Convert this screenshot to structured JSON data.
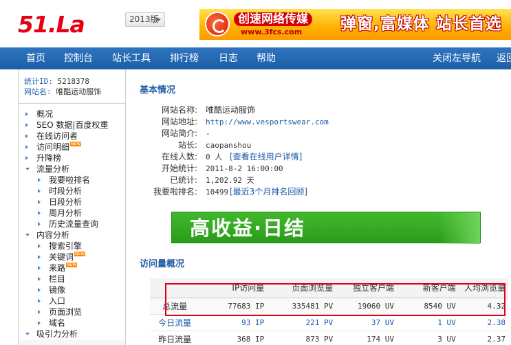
{
  "header": {
    "logo": "51.La",
    "version_label": "2013版",
    "banner": {
      "left_text": "创速网络传媒",
      "url_text": "www.3fcs.com",
      "right_text": "弹窗,富媒体 站长首选"
    }
  },
  "nav": {
    "items": [
      "首页",
      "控制台",
      "站长工具",
      "排行榜",
      "日志",
      "帮助"
    ],
    "right_items": [
      "关闭左导航",
      "返回"
    ]
  },
  "sidebar": {
    "site_id_label": "统计ID:",
    "site_id": "5218378",
    "site_name_label": "网站名:",
    "site_name": "唯酷运动服饰",
    "new_badge": "NEW",
    "menu": [
      {
        "label": "概况",
        "level": 1,
        "open": false,
        "new": false
      },
      {
        "label": "SEO 数据|百度权重",
        "level": 1,
        "open": false,
        "new": false
      },
      {
        "label": "在线访问者",
        "level": 1,
        "open": false,
        "new": false
      },
      {
        "label": "访问明细",
        "level": 1,
        "open": false,
        "new": true
      },
      {
        "label": "升降榜",
        "level": 1,
        "open": false,
        "new": false
      },
      {
        "label": "流量分析",
        "level": 1,
        "open": true,
        "new": false
      },
      {
        "label": "我要啦排名",
        "level": 2,
        "open": false,
        "new": false
      },
      {
        "label": "时段分析",
        "level": 2,
        "open": false,
        "new": false
      },
      {
        "label": "日段分析",
        "level": 2,
        "open": false,
        "new": false
      },
      {
        "label": "周月分析",
        "level": 2,
        "open": false,
        "new": false
      },
      {
        "label": "历史流量查询",
        "level": 2,
        "open": false,
        "new": false
      },
      {
        "label": "内容分析",
        "level": 1,
        "open": true,
        "new": false
      },
      {
        "label": "搜索引擎",
        "level": 2,
        "open": false,
        "new": false
      },
      {
        "label": "关键词",
        "level": 2,
        "open": false,
        "new": true
      },
      {
        "label": "来路",
        "level": 2,
        "open": false,
        "new": true
      },
      {
        "label": "栏目",
        "level": 2,
        "open": false,
        "new": false
      },
      {
        "label": "镜像",
        "level": 2,
        "open": false,
        "new": false
      },
      {
        "label": "入口",
        "level": 2,
        "open": false,
        "new": false
      },
      {
        "label": "页面浏览",
        "level": 2,
        "open": false,
        "new": false
      },
      {
        "label": "域名",
        "level": 2,
        "open": false,
        "new": false
      },
      {
        "label": "吸引力分析",
        "level": 1,
        "open": true,
        "new": false
      }
    ]
  },
  "main": {
    "basic_title": "基本情况",
    "basic": {
      "site_name_label": "网站名称:",
      "site_name": "唯酷运动服饰",
      "site_url_label": "网站地址:",
      "site_url": "http://www.vesportswear.com",
      "site_desc_label": "网站简介:",
      "site_desc": "-",
      "owner_label": "站长:",
      "owner": "caopanshou",
      "online_label": "在线人数:",
      "online_value": "0 人",
      "online_link": "[查看在线用户详情]",
      "start_label": "开始统计:",
      "start_value": "2011-8-2 16:00:00",
      "counted_label": "已统计:",
      "counted_value": "1,202.92 天",
      "rank_label": "我要啦排名:",
      "rank_value": "10499",
      "rank_link": "[最近3个月排名回顾]"
    },
    "ad_text": "高收益·日结",
    "visits_title": "访问量概况",
    "table": {
      "headers": [
        "",
        "IP访问量",
        "页面浏览量",
        "独立客户端",
        "新客户端",
        "人均浏览量"
      ],
      "rows": [
        {
          "label": "总流量",
          "ip": "77683 IP",
          "pv": "335481 PV",
          "uv": "19060 UV",
          "new_uv": "8540 UV",
          "avg": "4.32"
        },
        {
          "label": "今日流量",
          "ip": "93 IP",
          "pv": "221 PV",
          "uv": "37 UV",
          "new_uv": "1 UV",
          "avg": "2.38"
        },
        {
          "label": "昨日流量",
          "ip": "368 IP",
          "pv": "873 PV",
          "uv": "174 UV",
          "new_uv": "3 UV",
          "avg": "2.37"
        }
      ]
    }
  }
}
